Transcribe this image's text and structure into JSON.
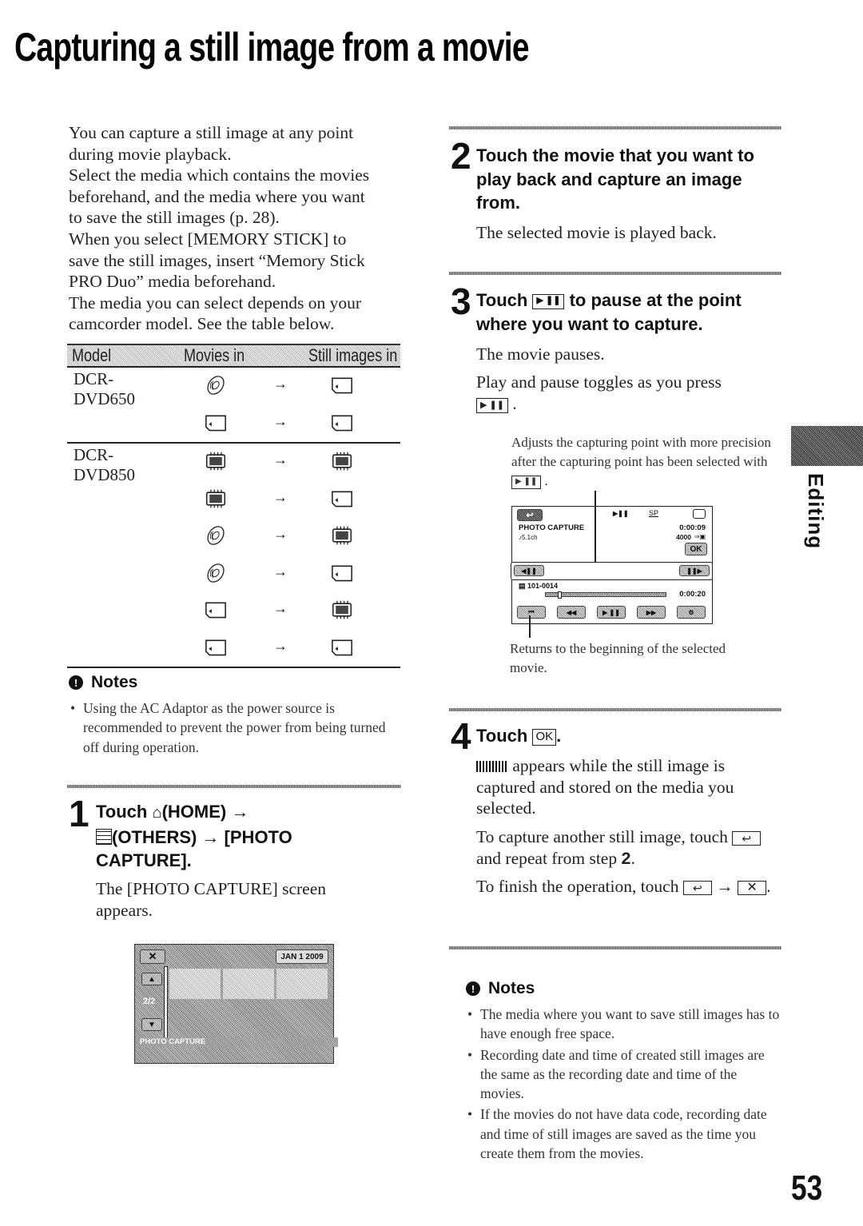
{
  "page": {
    "title": "Capturing a still image from a movie",
    "page_number": "53",
    "side_tab_label": "Editing"
  },
  "intro": {
    "lines": [
      "You can capture a still image at any point",
      "during movie playback.",
      "Select the media which contains the movies",
      "beforehand, and the media where you want",
      "to save the still images (p. 28).",
      "When you select [MEMORY STICK] to",
      "save the still images, insert “Memory Stick",
      "PRO Duo” media beforehand.",
      "The media you can select depends on your",
      "camcorder model. See the table below."
    ]
  },
  "media_table": {
    "headers": [
      "Model",
      "Movies in",
      "Still images in"
    ],
    "arrow": "→",
    "groups": [
      {
        "model_line1": "DCR-",
        "model_line2": "DVD650",
        "rows": [
          {
            "from": "disc-icon",
            "to": "memory-stick-icon"
          },
          {
            "from": "memory-stick-icon",
            "to": "memory-stick-icon"
          }
        ]
      },
      {
        "model_line1": "DCR-",
        "model_line2": "DVD850",
        "rows": [
          {
            "from": "internal-memory-icon",
            "to": "internal-memory-icon"
          },
          {
            "from": "internal-memory-icon",
            "to": "memory-stick-icon"
          },
          {
            "from": "disc-icon",
            "to": "internal-memory-icon"
          },
          {
            "from": "disc-icon",
            "to": "memory-stick-icon"
          },
          {
            "from": "memory-stick-icon",
            "to": "internal-memory-icon"
          },
          {
            "from": "memory-stick-icon",
            "to": "memory-stick-icon"
          }
        ]
      }
    ]
  },
  "notes_left": {
    "heading": "Notes",
    "items": [
      "Using the AC Adaptor as the power source is recommended to prevent the power from being turned off during operation."
    ]
  },
  "step1": {
    "number": "1",
    "heading_line1_a": "Touch",
    "heading_line1_b": "(HOME) →",
    "heading_line2": "(OTHERS) → [PHOTO",
    "heading_line3": "CAPTURE].",
    "body": "The [PHOTO CAPTURE] screen appears.",
    "screen": {
      "close_label": "✕",
      "date": "JAN  1 2009",
      "page_indicator": "2/2",
      "up_label": "▲",
      "down_label": "▼",
      "footer_label": "PHOTO CAPTURE"
    }
  },
  "step2": {
    "number": "2",
    "heading": "Touch the movie that you want to play back and capture an image from.",
    "body": "The selected movie is played back."
  },
  "step3": {
    "number": "3",
    "heading_a": "Touch",
    "heading_icon": "▶ ❚❚",
    "heading_b": "to pause at the point where you want to capture.",
    "body1": "The movie pauses.",
    "body2": "Play and pause toggles as you press",
    "callout_top": "Adjusts the capturing point with more precision after the capturing point has been selected with",
    "callout_bottom": "Returns to the beginning of the selected movie.",
    "screen": {
      "back_label": "↩",
      "mode_label": "PHOTO CAPTURE",
      "audio_label": "♪5.1ch",
      "play_state": "▶❚❚",
      "quality": "SP",
      "elapsed": "0:00:09",
      "remaining_shots": "4000",
      "ok_label": "OK",
      "frame_back": "◀❚❚",
      "frame_fwd": "❚❚▶",
      "file_number": "101-0014",
      "total_time": "0:00:20",
      "progress": 0.1,
      "controls": [
        "⏮",
        "◀◀",
        "▶ ❚❚",
        "▶▶",
        "⚙"
      ]
    }
  },
  "step4": {
    "number": "4",
    "heading_a": "Touch",
    "ok_icon": "OK",
    "body1": "appears while the still image is captured and stored on the media you selected.",
    "body2_a": "To capture another still image, touch",
    "body2_b": "and repeat from step",
    "body2_step": "2",
    "body3_a": "To finish the operation, touch",
    "return_icon": "↩",
    "arrow": "→",
    "close_icon": "✕"
  },
  "notes_right": {
    "heading": "Notes",
    "items": [
      "The media where you want to save still images has to have enough free space.",
      "Recording date and time of created still images are the same as the recording date and time of the movies.",
      "If the movies do not have data code, recording date and time of still images are saved as the time you create them from the movies."
    ]
  }
}
